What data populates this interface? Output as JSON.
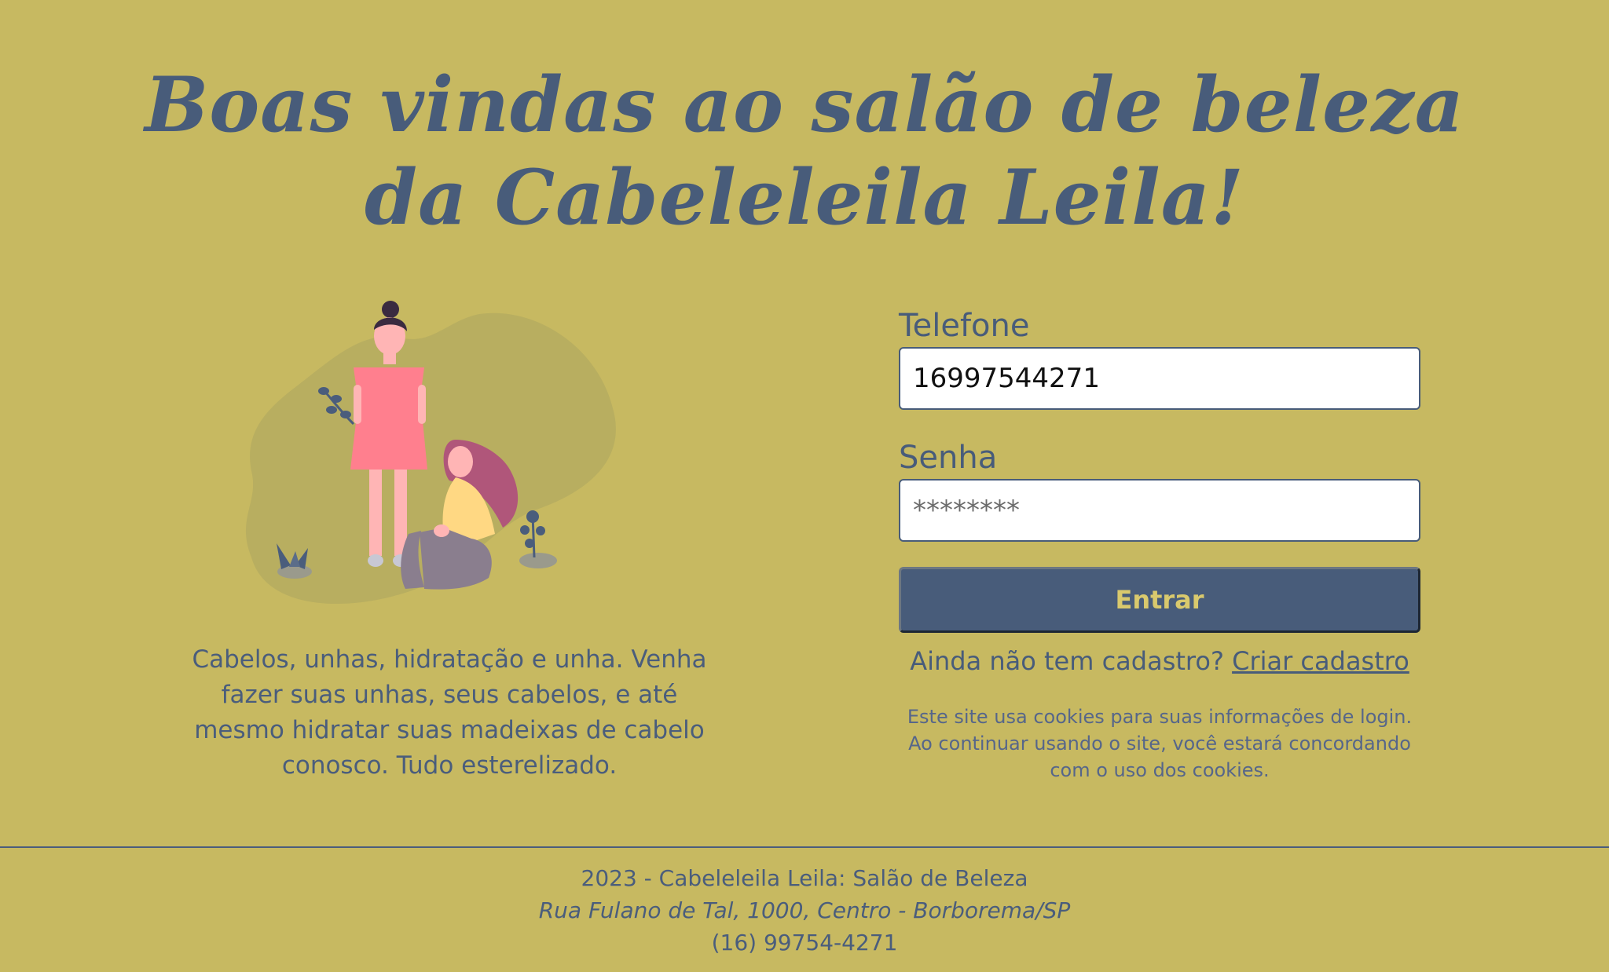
{
  "header": {
    "title": "Boas vindas ao salão de beleza da Cabeleleila Leila!"
  },
  "intro": {
    "description": "Cabelos, unhas, hidratação e unha. Venha fazer suas unhas, seus cabelos, e até mesmo hidratar suas madeixas de cabelo conosco. Tudo esterelizado."
  },
  "login": {
    "phone_label": "Telefone",
    "phone_value": "16997544271",
    "password_label": "Senha",
    "password_value": "********",
    "submit_label": "Entrar"
  },
  "signup": {
    "prompt": "Ainda não tem cadastro?",
    "link_label": "Criar cadastro"
  },
  "cookie_notice": "Este site usa cookies para suas informações de login. Ao continuar usando o site, você estará concordando com o uso dos cookies.",
  "footer": {
    "copyright": "2023 - Cabeleleila Leila: Salão de Beleza",
    "address": "Rua Fulano de Tal, 1000, Centro - Borborema/SP",
    "phone": "(16) 99754-4271"
  },
  "colors": {
    "background": "#c7b961",
    "primary": "#485c7a",
    "button_text": "#d9c96d",
    "dress": "#ff7f8e",
    "hair_accent": "#b0567a"
  }
}
